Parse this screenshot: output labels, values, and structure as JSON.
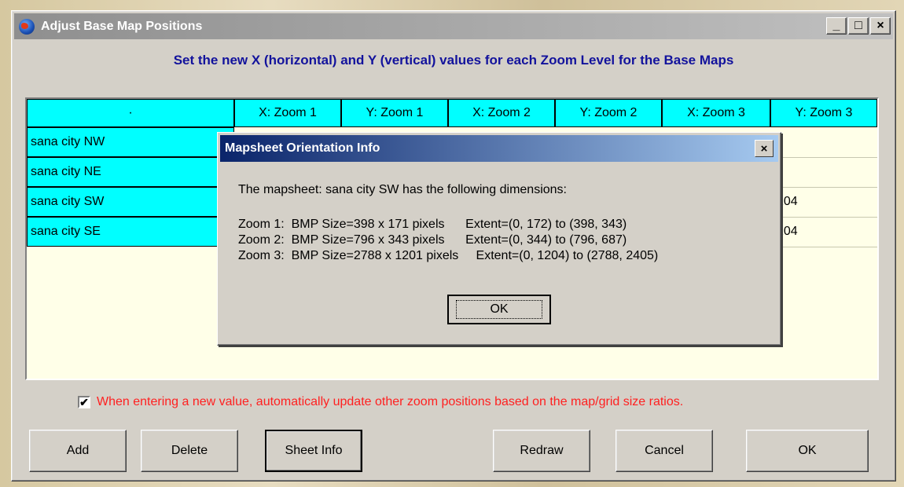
{
  "window": {
    "title": "Adjust Base Map Positions",
    "controls": [
      "_",
      "□",
      "×"
    ]
  },
  "heading": "Set the new X (horizontal) and Y (vertical) values for each Zoom Level for the Base Maps",
  "table": {
    "headers": [
      "·",
      "X: Zoom 1",
      "Y: Zoom 1",
      "X: Zoom 2",
      "Y: Zoom 2",
      "X: Zoom 3",
      "Y: Zoom 3"
    ],
    "rows": [
      {
        "name": "sana city NW",
        "y_zoom3": ""
      },
      {
        "name": "sana city NE",
        "y_zoom3": ""
      },
      {
        "name": "sana city SW",
        "y_zoom3": "204"
      },
      {
        "name": "sana city SE",
        "y_zoom3": "204"
      }
    ]
  },
  "dialog": {
    "title": "Mapsheet Orientation Info",
    "close": "×",
    "intro": "The mapsheet: sana city SW has the following dimensions:",
    "lines": [
      "Zoom 1:  BMP Size=398 x 171 pixels      Extent=(0, 172) to (398, 343)",
      "Zoom 2:  BMP Size=796 x 343 pixels      Extent=(0, 344) to (796, 687)",
      "Zoom 3:  BMP Size=2788 x 1201 pixels     Extent=(0, 1204) to (2788, 2405)"
    ],
    "ok": "OK"
  },
  "auto_update": {
    "checked": true,
    "mark": "✔",
    "label": "When entering a new value, automatically update other zoom positions based on the map/grid size ratios."
  },
  "buttons": {
    "add": "Add",
    "delete": "Delete",
    "sheet_info": "Sheet Info",
    "redraw": "Redraw",
    "cancel": "Cancel",
    "ok": "OK"
  }
}
